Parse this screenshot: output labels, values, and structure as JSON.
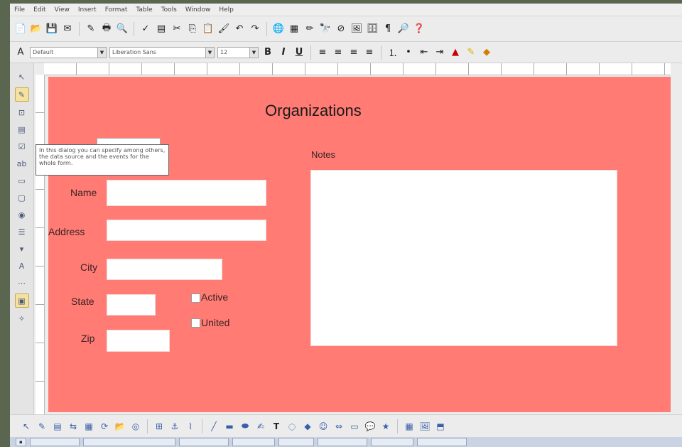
{
  "menu": [
    "File",
    "Edit",
    "View",
    "Insert",
    "Format",
    "Table",
    "Tools",
    "Window",
    "Help"
  ],
  "format_toolbar": {
    "style_value": "Default",
    "font_value": "Liberation Sans",
    "size_value": "12",
    "bold": "B",
    "italic": "I",
    "underline": "U"
  },
  "form": {
    "title": "Organizations",
    "labels": {
      "name": "Name",
      "address": "Address",
      "city": "City",
      "state": "State",
      "zip": "Zip",
      "notes": "Notes"
    },
    "checkboxes": [
      "Active",
      "United"
    ]
  },
  "tooltip": {
    "text": "In this dialog you can specify among others, the data source and the events for the whole form."
  },
  "colors": {
    "page_background": "#ff7b74",
    "field_background": "#ffffff"
  }
}
